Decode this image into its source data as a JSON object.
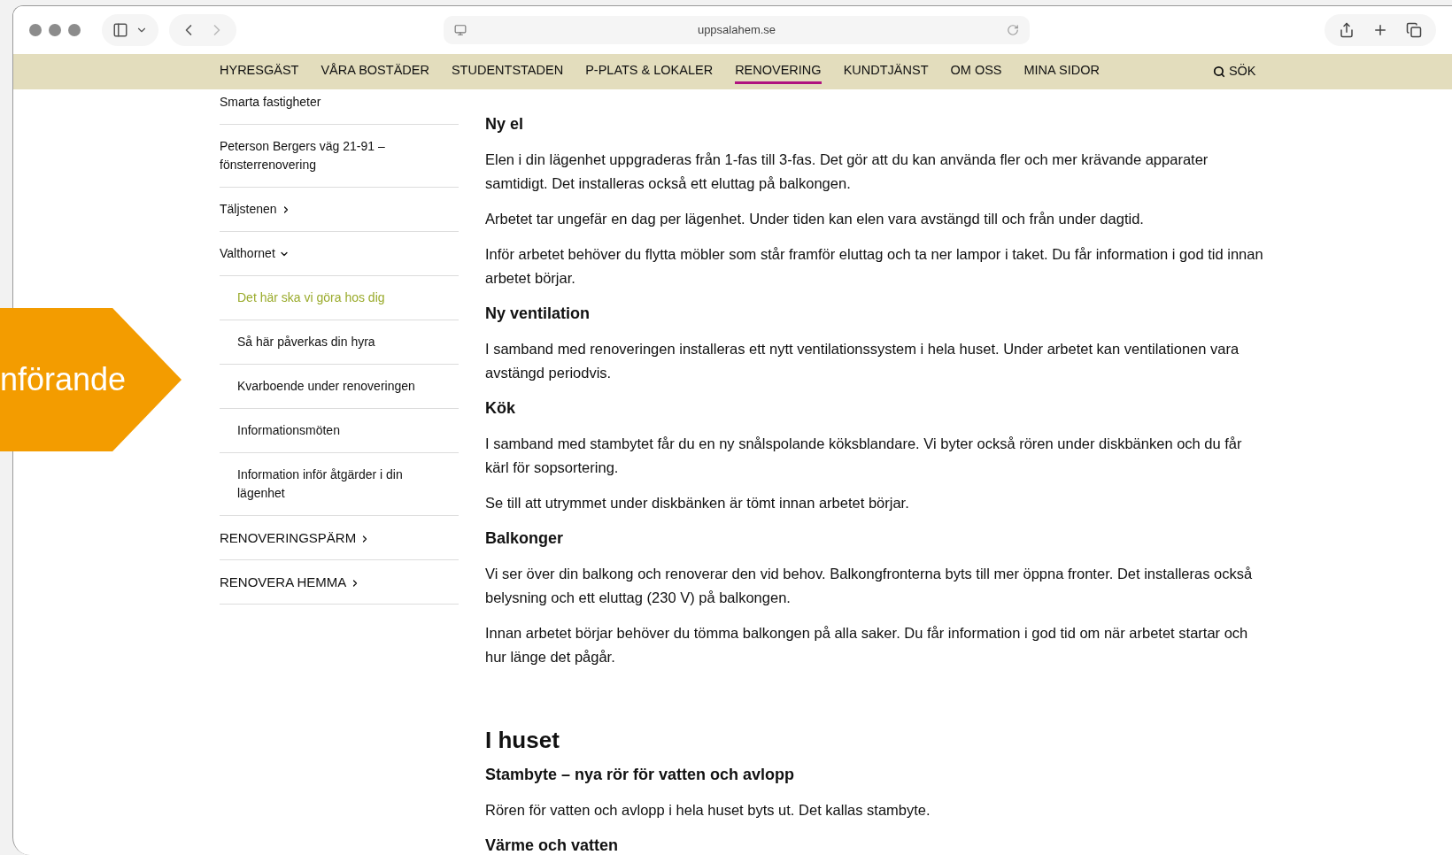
{
  "browser": {
    "url": "uppsalahem.se"
  },
  "nav": {
    "items": [
      {
        "label": "HYRESGÄST",
        "selected": false
      },
      {
        "label": "VÅRA BOSTÄDER",
        "selected": false
      },
      {
        "label": "STUDENTSTADEN",
        "selected": false
      },
      {
        "label": "P-PLATS & LOKALER",
        "selected": false
      },
      {
        "label": "RENOVERING",
        "selected": true
      },
      {
        "label": "KUNDTJÄNST",
        "selected": false
      },
      {
        "label": "OM OSS",
        "selected": false
      },
      {
        "label": "MINA SIDOR",
        "selected": false
      }
    ],
    "search": "SÖK"
  },
  "sidebar": {
    "items": [
      {
        "label": "Smarta fastigheter",
        "kind": "page",
        "selected": false
      },
      {
        "label": "Peterson Bergers väg 21-91 – fönsterrenovering",
        "kind": "page",
        "selected": false
      },
      {
        "label": "Täljstenen",
        "kind": "folder",
        "expanded": false,
        "selected": false
      },
      {
        "label": "Valthornet",
        "kind": "folder",
        "expanded": true,
        "selected": false,
        "children": [
          {
            "label": "Det här ska vi göra hos dig",
            "kind": "page",
            "selected": true
          },
          {
            "label": "Så här påverkas din hyra",
            "kind": "page",
            "selected": false
          },
          {
            "label": "Kvarboende under renoveringen",
            "kind": "page",
            "selected": false
          },
          {
            "label": "Informationsmöten",
            "kind": "page",
            "selected": false
          },
          {
            "label": "Information inför åtgärder i din lägenhet",
            "kind": "page",
            "selected": false
          }
        ]
      },
      {
        "label": "RENOVERINGSPÄRM",
        "kind": "section",
        "expanded": false,
        "selected": false
      },
      {
        "label": "RENOVERA HEMMA",
        "kind": "section",
        "expanded": false,
        "selected": false
      }
    ]
  },
  "content": {
    "blocks": [
      {
        "kind": "subheading",
        "text": "Ny el"
      },
      {
        "kind": "paragraph",
        "text": "Elen i din lägenhet uppgraderas från 1-fas till 3-fas. Det gör att du kan använda fler och mer krävande apparater samtidigt. Det installeras också ett eluttag på balkongen."
      },
      {
        "kind": "paragraph",
        "text": "Arbetet tar ungefär en dag per lägenhet. Under tiden kan elen vara avstängd till och från under dagtid."
      },
      {
        "kind": "paragraph",
        "text": "Inför arbetet behöver du flytta möbler som står framför eluttag och ta ner lampor i taket. Du får information i god tid innan arbetet börjar."
      },
      {
        "kind": "subheading",
        "text": "Ny ventilation"
      },
      {
        "kind": "paragraph",
        "text": "I samband med renoveringen installeras ett nytt ventilationssystem i hela huset. Under arbetet kan ventilationen vara avstängd periodvis."
      },
      {
        "kind": "subheading",
        "text": "Kök"
      },
      {
        "kind": "paragraph",
        "text": "I samband med stambytet får du en ny snålspolande köksblandare. Vi byter också rören under diskbänken och du får kärl för sopsortering."
      },
      {
        "kind": "paragraph",
        "text": "Se till att utrymmet under diskbänken är tömt innan arbetet börjar."
      },
      {
        "kind": "subheading",
        "text": "Balkonger"
      },
      {
        "kind": "paragraph",
        "text": "Vi ser över din balkong och renoverar den vid behov. Balkongfronterna byts till mer öppna fronter. Det installeras också belysning och ett eluttag (230 V) på balkongen."
      },
      {
        "kind": "paragraph",
        "text": "Innan arbetet börjar behöver du tömma balkongen på alla saker. Du får information i god tid om när arbetet startar och hur länge det pågår."
      },
      {
        "kind": "heading",
        "text": "I huset"
      },
      {
        "kind": "subheading",
        "text": "Stambyte – nya rör för vatten och avlopp"
      },
      {
        "kind": "paragraph",
        "text": "Rören för vatten och avlopp i hela huset byts ut. Det kallas stambyte."
      },
      {
        "kind": "subheading",
        "text": "Värme och vatten"
      }
    ]
  },
  "callout": {
    "text": "nförande"
  }
}
